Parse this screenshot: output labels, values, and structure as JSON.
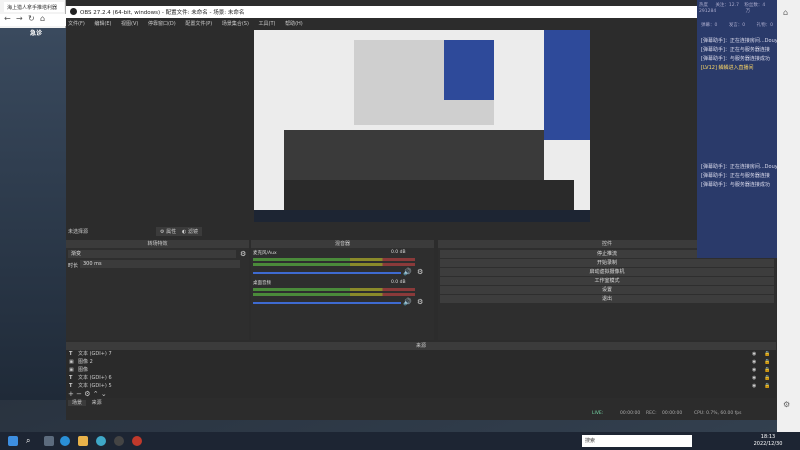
{
  "browser": {
    "tab_title": "海上猎人拿手推塔利器",
    "page_text": "急诊"
  },
  "obs": {
    "window_title": "OBS 27.2.4 (64-bit, windows) - 配置文件: 未命名 - 场景: 未命名",
    "menu": [
      "文件(F)",
      "编辑(E)",
      "视图(V)",
      "停靠窗口(D)",
      "配置文件(P)",
      "场景集合(S)",
      "工具(T)",
      "帮助(H)"
    ],
    "scene_status": "未选择源",
    "source_props_label": "属性",
    "source_filters_label": "滤镜",
    "docks": {
      "scene_transition_title": "转场特效",
      "mixer_title": "混音器",
      "controls_title": "控件",
      "transition_name": "渐变",
      "duration_label": "时长",
      "duration_value": "300 ms",
      "mixer_channels": [
        {
          "name": "麦克风/Aux",
          "db": "0.0 dB"
        },
        {
          "name": "桌面音频",
          "db": "0.0 dB"
        }
      ],
      "controls": [
        "停止推流",
        "开始录制",
        "启动虚拟摄像机",
        "工作室模式",
        "设置",
        "退出"
      ]
    },
    "sources_title": "来源",
    "sources": [
      {
        "icon": "text-icon",
        "label": "文本 (GDI+) 7"
      },
      {
        "icon": "image-icon",
        "label": "图像 2"
      },
      {
        "icon": "image-icon",
        "label": "图像"
      },
      {
        "icon": "text-icon",
        "label": "文本 (GDI+) 6"
      },
      {
        "icon": "text-icon",
        "label": "文本 (GDI+) 5"
      }
    ],
    "bottom_tabs": [
      "场景",
      "来源"
    ],
    "status": {
      "live_label": "LIVE:",
      "live_time": "00:00:00",
      "rec_label": "REC:",
      "rec_time": "00:00:00",
      "cpu": "CPU: 0.7%, 60.00 fps"
    }
  },
  "chat": {
    "header": [
      "热度",
      "关注：12.7",
      "粉丝数：4",
      "291284",
      "万"
    ],
    "stats": [
      "弹幕：0",
      "发言：0",
      "礼物：0"
    ],
    "messages": [
      "[弹幕助手]：正在连接房间...Douyu/5244019",
      "[弹幕助手]：正在与服务器连接",
      "[弹幕助手]：与服务器连接成功",
      "[LV12] 鳞鳞进入直播间",
      "[弹幕助手]：正在连接房间...Douyu/5244019",
      "[弹幕助手]：正在与服务器连接",
      "[弹幕助手]：与服务器连接成功"
    ]
  },
  "taskbar": {
    "search_placeholder": "搜索",
    "time": "18:13",
    "date": "2022/12/30"
  },
  "colors": {
    "obs_bg": "#2c2c2c",
    "chat_bg": "#2a3a6a",
    "accent": "#3e6ad0"
  }
}
